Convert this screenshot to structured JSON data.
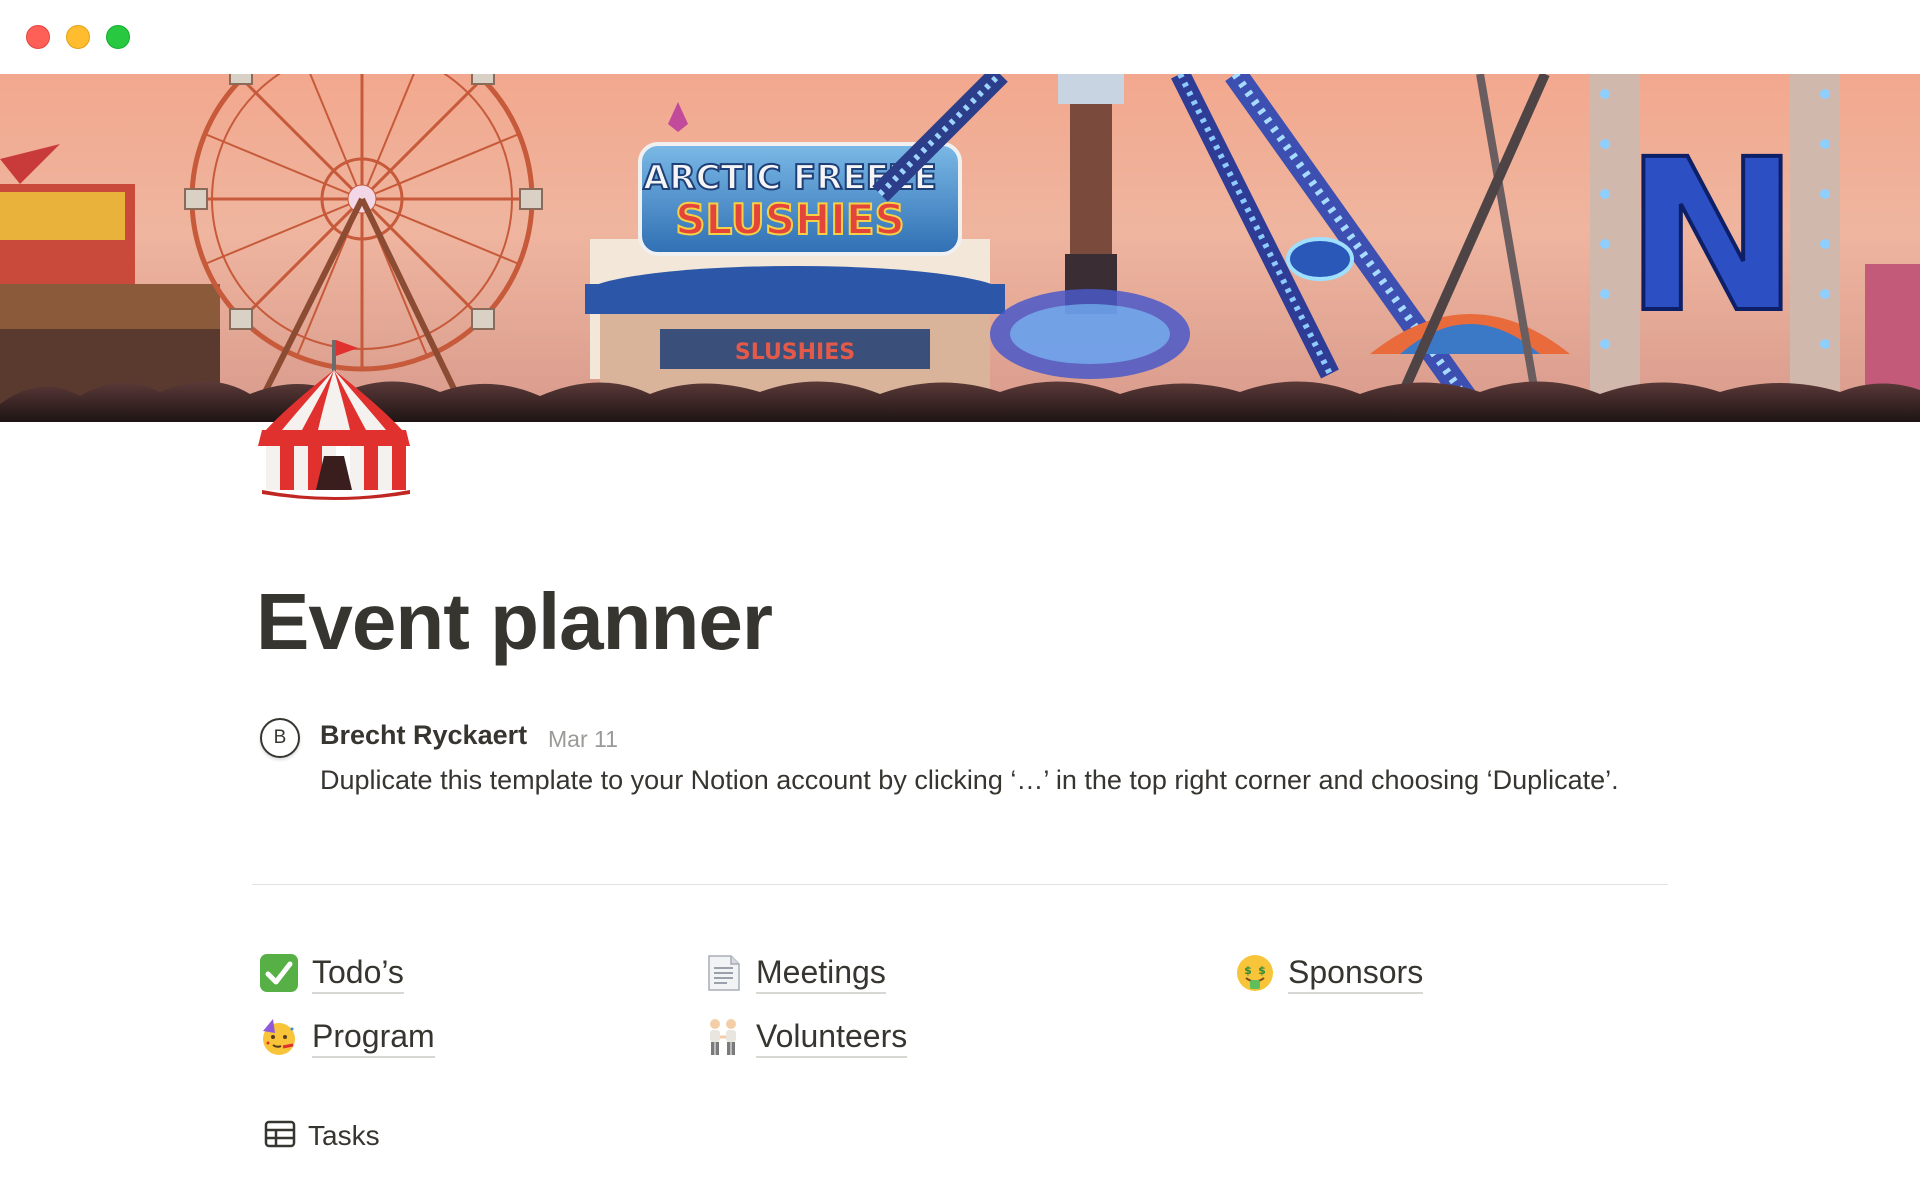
{
  "window": {
    "controls": [
      "close",
      "minimize",
      "zoom"
    ]
  },
  "cover": {
    "sign_top": "ARCTIC FREEZE",
    "sign_bottom": "SLUSHIES",
    "sign_small": "SLUSHIES",
    "letter": "N"
  },
  "page": {
    "icon": "circus-tent-icon",
    "title": "Event planner"
  },
  "comment": {
    "avatar_initial": "B",
    "author": "Brecht Ryckaert",
    "date": "Mar 11",
    "text": "Duplicate this template to your Notion account by clicking ‘…’ in the top right corner and choosing ‘Duplicate’."
  },
  "links": [
    {
      "label": "Todo’s",
      "icon": "check-mark-icon"
    },
    {
      "label": "Meetings",
      "icon": "page-facing-up-icon"
    },
    {
      "label": "Sponsors",
      "icon": "money-mouth-face-icon"
    },
    {
      "label": "Program",
      "icon": "partying-face-icon"
    },
    {
      "label": "Volunteers",
      "icon": "people-holding-hands-icon"
    }
  ],
  "database": {
    "icon": "table-icon",
    "title": "Tasks"
  },
  "colors": {
    "text": "#37352f",
    "muted": "#9b9a97",
    "divider": "#e3e2e0",
    "check_green": "#57b046"
  }
}
